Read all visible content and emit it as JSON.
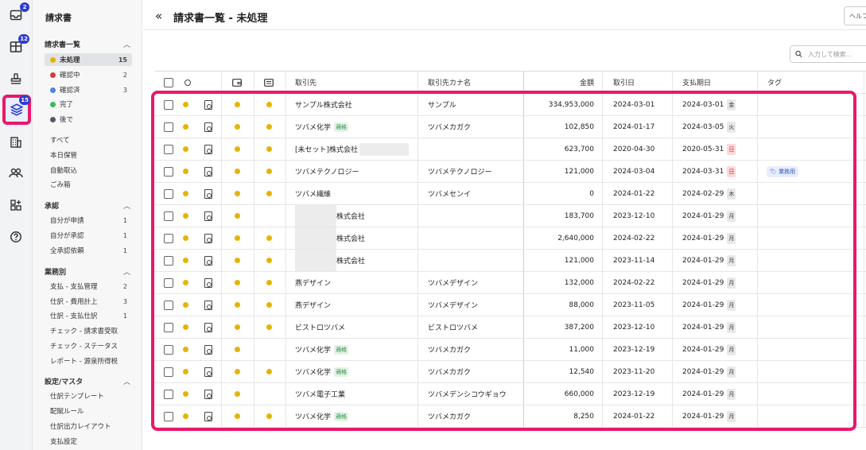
{
  "rail": {
    "inbox_badge": "2",
    "journal_badge": "12",
    "invoice_badge": "15"
  },
  "nav": {
    "title": "請求書",
    "sections": {
      "invoices": "請求書一覧",
      "approval": "承認",
      "business": "業務別",
      "settings": "設定/マスタ"
    },
    "status_items": [
      {
        "label": "未処理",
        "count": "15",
        "color": "#e5b400"
      },
      {
        "label": "確認中",
        "count": "2",
        "color": "#d93a3a"
      },
      {
        "label": "確認済",
        "count": "3",
        "color": "#4f82e8"
      },
      {
        "label": "完了",
        "count": "",
        "color": "#3cba58"
      },
      {
        "label": "後で",
        "count": "",
        "color": "#555b66"
      }
    ],
    "other_items": [
      "すべて",
      "本日保管",
      "自動取込",
      "ごみ箱"
    ],
    "approval_items": [
      {
        "label": "自分が申請",
        "count": "1"
      },
      {
        "label": "自分が承認",
        "count": "1"
      },
      {
        "label": "全承認依頼",
        "count": "1"
      }
    ],
    "business_items": [
      {
        "label": "支払 - 支払管理",
        "count": "2"
      },
      {
        "label": "仕訳 - 費用計上",
        "count": "3"
      },
      {
        "label": "仕訳 - 支払仕訳",
        "count": "1"
      },
      {
        "label": "チェック - 請求書受取",
        "count": ""
      },
      {
        "label": "チェック - ステータス",
        "count": ""
      },
      {
        "label": "レポート - 源泉所得税",
        "count": ""
      }
    ],
    "settings_items": [
      "仕訳テンプレート",
      "配賦ルール",
      "仕訳出力レイアウト",
      "支払設定"
    ]
  },
  "header": {
    "title": "請求書一覧 - 未処理",
    "help_label": "ヘルプ"
  },
  "search": {
    "placeholder": "入力して検索..."
  },
  "table": {
    "columns": {
      "partner": "取引先",
      "partner_kana": "取引先カナ名",
      "amount": "金額",
      "txn_date": "取引日",
      "due_date": "支払期日",
      "tag": "タグ"
    },
    "rows": [
      {
        "partner": "サンプル株式会社",
        "badge": "",
        "kana": "サンプル",
        "amount": "334,953,000",
        "txn": "2024-03-01",
        "due": "2024-03-01",
        "day": "金",
        "day_red": false,
        "tag": "",
        "dot2": true,
        "dot3": true,
        "blurred": false
      },
      {
        "partner": "ツバメ化学",
        "badge": "適格",
        "kana": "ツバメカガク",
        "amount": "102,850",
        "txn": "2024-01-17",
        "due": "2024-03-05",
        "day": "火",
        "day_red": false,
        "tag": "",
        "dot2": true,
        "dot3": true,
        "blurred": false
      },
      {
        "partner": "[未セット]株式会社",
        "badge": "",
        "kana": "",
        "amount": "623,700",
        "txn": "2020-04-30",
        "due": "2020-05-31",
        "day": "日",
        "day_red": true,
        "tag": "",
        "dot2": true,
        "dot3": true,
        "blurred": false
      },
      {
        "partner": "ツバメテクノロジー",
        "badge": "",
        "kana": "ツバメテクノロジー",
        "amount": "121,000",
        "txn": "2024-03-04",
        "due": "2024-03-31",
        "day": "日",
        "day_red": true,
        "tag": "業務用",
        "dot2": true,
        "dot3": true,
        "blurred": false
      },
      {
        "partner": "ツバメ繊維",
        "badge": "",
        "kana": "ツバメセンイ",
        "amount": "0",
        "txn": "2024-01-22",
        "due": "2024-02-29",
        "day": "木",
        "day_red": false,
        "tag": "",
        "dot2": true,
        "dot3": true,
        "blurred": false
      },
      {
        "partner": "株式会社",
        "badge": "",
        "kana": "",
        "amount": "183,700",
        "txn": "2023-12-10",
        "due": "2024-01-29",
        "day": "月",
        "day_red": false,
        "tag": "",
        "dot2": true,
        "dot3": false,
        "blurred": true
      },
      {
        "partner": "株式会社",
        "badge": "",
        "kana": "",
        "amount": "2,640,000",
        "txn": "2024-02-22",
        "due": "2024-01-29",
        "day": "月",
        "day_red": false,
        "tag": "",
        "dot2": true,
        "dot3": true,
        "blurred": true
      },
      {
        "partner": "株式会社",
        "badge": "",
        "kana": "",
        "amount": "121,000",
        "txn": "2023-11-14",
        "due": "2024-01-29",
        "day": "月",
        "day_red": false,
        "tag": "",
        "dot2": true,
        "dot3": true,
        "blurred": true
      },
      {
        "partner": "燕デザイン",
        "badge": "",
        "kana": "ツバメデザイン",
        "amount": "132,000",
        "txn": "2024-02-22",
        "due": "2024-01-29",
        "day": "月",
        "day_red": false,
        "tag": "",
        "dot2": true,
        "dot3": true,
        "blurred": false
      },
      {
        "partner": "燕デザイン",
        "badge": "",
        "kana": "ツバメデザイン",
        "amount": "88,000",
        "txn": "2023-11-05",
        "due": "2024-01-29",
        "day": "月",
        "day_red": false,
        "tag": "",
        "dot2": true,
        "dot3": true,
        "blurred": false
      },
      {
        "partner": "ビストロツバメ",
        "badge": "",
        "kana": "ビストロツバメ",
        "amount": "387,200",
        "txn": "2023-12-10",
        "due": "2024-01-29",
        "day": "月",
        "day_red": false,
        "tag": "",
        "dot2": true,
        "dot3": true,
        "blurred": false
      },
      {
        "partner": "ツバメ化学",
        "badge": "適格",
        "kana": "ツバメカガク",
        "amount": "11,000",
        "txn": "2023-12-19",
        "due": "2024-01-29",
        "day": "月",
        "day_red": false,
        "tag": "",
        "dot2": true,
        "dot3": false,
        "blurred": false
      },
      {
        "partner": "ツバメ化学",
        "badge": "適格",
        "kana": "ツバメカガク",
        "amount": "12,540",
        "txn": "2023-11-20",
        "due": "2024-01-29",
        "day": "月",
        "day_red": false,
        "tag": "",
        "dot2": true,
        "dot3": true,
        "blurred": false
      },
      {
        "partner": "ツバメ電子工業",
        "badge": "",
        "kana": "ツバメデンシコウギョウ",
        "amount": "660,000",
        "txn": "2023-12-19",
        "due": "2024-01-29",
        "day": "月",
        "day_red": false,
        "tag": "",
        "dot2": true,
        "dot3": false,
        "blurred": false
      },
      {
        "partner": "ツバメ化学",
        "badge": "適格",
        "kana": "ツバメカガク",
        "amount": "8,250",
        "txn": "2024-01-22",
        "due": "2024-01-29",
        "day": "月",
        "day_red": false,
        "tag": "",
        "dot2": true,
        "dot3": true,
        "blurred": false
      }
    ]
  }
}
